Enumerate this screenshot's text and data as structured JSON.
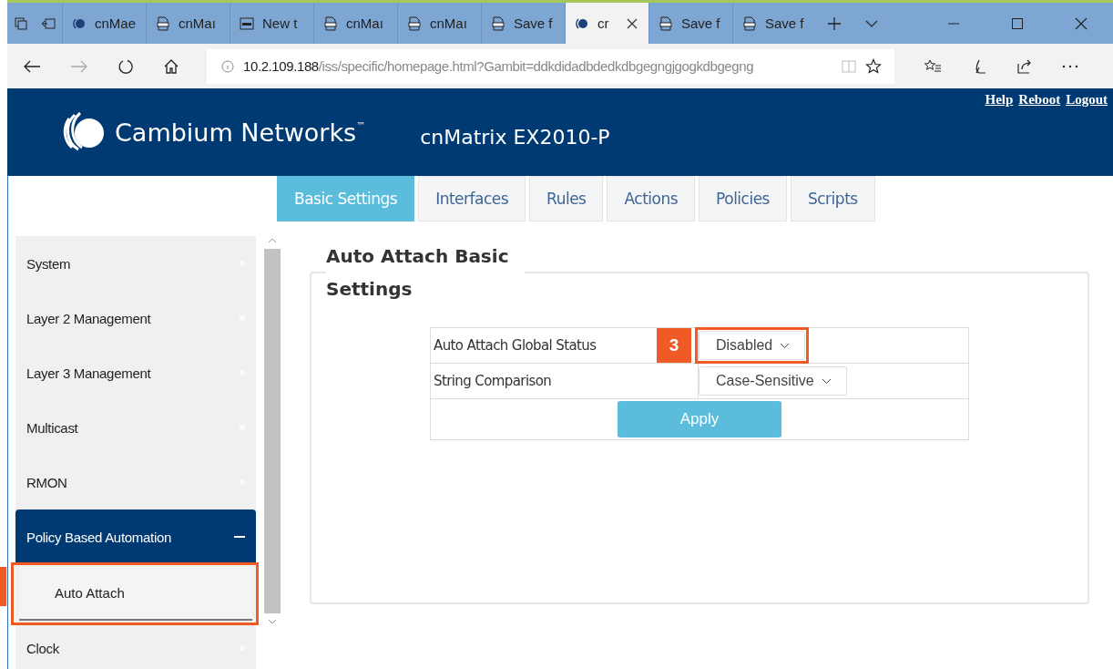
{
  "browser": {
    "tabs": [
      {
        "kind": "cambium",
        "label": "cnMaе",
        "selected": false
      },
      {
        "kind": "pdf",
        "label": "cnMaı",
        "selected": false
      },
      {
        "kind": "page",
        "label": "New t",
        "selected": false
      },
      {
        "kind": "pdf",
        "label": "cnMaı",
        "selected": false
      },
      {
        "kind": "pdf",
        "label": "cnMaı",
        "selected": false
      },
      {
        "kind": "pdf",
        "label": "Save f",
        "selected": false
      },
      {
        "kind": "cambium",
        "label": "cr",
        "selected": true
      },
      {
        "kind": "pdf",
        "label": "Save f",
        "selected": false
      },
      {
        "kind": "pdf",
        "label": "Save f",
        "selected": false
      }
    ],
    "address": {
      "host": "10.2.109.188",
      "path": "/iss/specific/homepage.html?Gambit=ddkdidadbdedkdbgegngjgogkdbgegng"
    }
  },
  "header": {
    "brand": "Cambium Networks",
    "trademark": "™",
    "product": "cnMatrix EX2010-P",
    "links": [
      "Help",
      "Reboot",
      "Logout"
    ]
  },
  "tabs": [
    {
      "label": "Basic Settings",
      "selected": true
    },
    {
      "label": "Interfaces",
      "selected": false
    },
    {
      "label": "Rules",
      "selected": false
    },
    {
      "label": "Actions",
      "selected": false
    },
    {
      "label": "Policies",
      "selected": false
    },
    {
      "label": "Scripts",
      "selected": false
    }
  ],
  "sidebar": {
    "items": [
      {
        "label": "System",
        "expanded": false,
        "selected": false
      },
      {
        "label": "Layer 2 Management",
        "expanded": false,
        "selected": false
      },
      {
        "label": "Layer 3 Management",
        "expanded": false,
        "selected": false
      },
      {
        "label": "Multicast",
        "expanded": false,
        "selected": false
      },
      {
        "label": "RMON",
        "expanded": false,
        "selected": false
      },
      {
        "label": "Policy Based Automation",
        "expanded": true,
        "selected": true,
        "children": [
          {
            "label": "Auto Attach",
            "selected": true
          }
        ]
      },
      {
        "label": "Clock",
        "expanded": false,
        "selected": false
      }
    ]
  },
  "panel": {
    "title": "Auto Attach Basic Settings",
    "fields": [
      {
        "label": "Auto Attach Global Status",
        "value": "Disabled",
        "callout": "3"
      },
      {
        "label": "String Comparison",
        "value": "Case-Sensitive"
      }
    ],
    "button": "Apply"
  }
}
